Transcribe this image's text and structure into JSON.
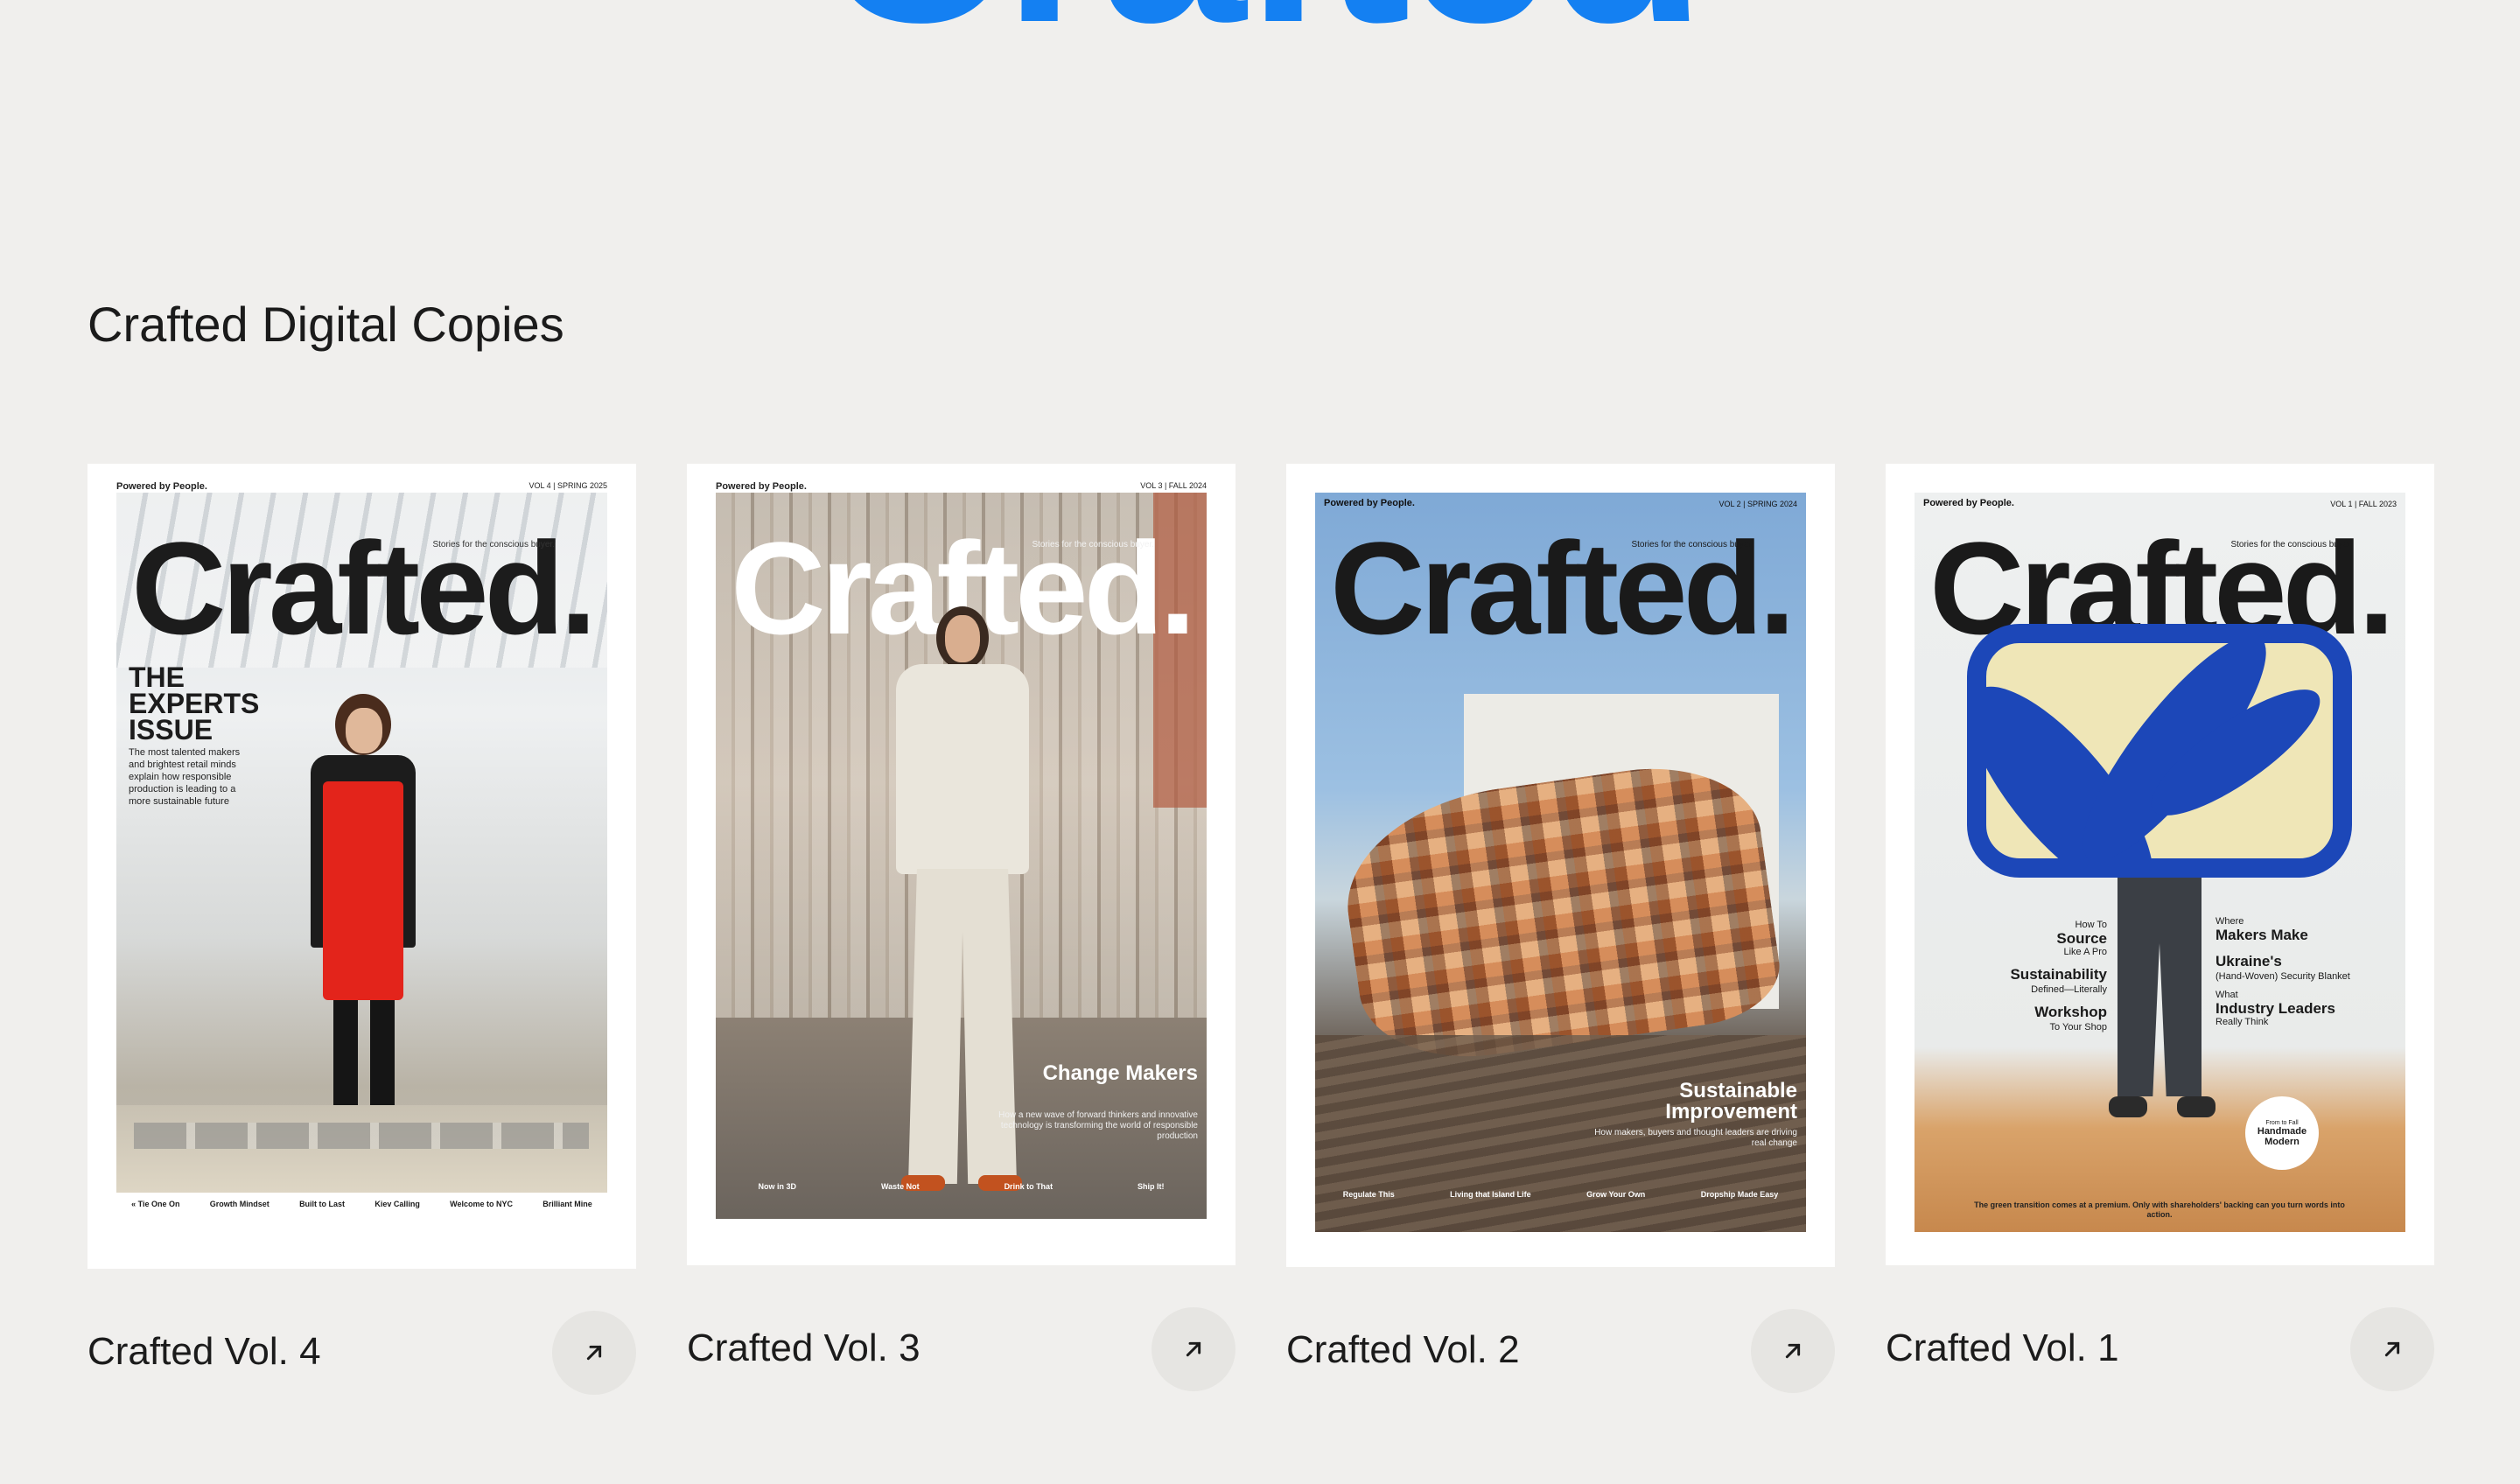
{
  "hero": {
    "partial_text": "Crafted"
  },
  "section": {
    "title": "Crafted Digital Copies"
  },
  "colors": {
    "accent": "#1480f2",
    "background": "#f0efed",
    "button_bg": "#e6e5e2"
  },
  "cards": [
    {
      "title": "Crafted Vol. 4",
      "cover": {
        "brand": "Powered by People.",
        "vol": "VOL 4 | SPRING 2025",
        "masthead": "Crafted.",
        "tagline": "Stories for the conscious buyer.",
        "headline": "THE EXPERTS ISSUE",
        "subhead": "The most talented makers and brightest retail minds explain how responsible production is leading to a more sustainable future",
        "footer": [
          "« Tie One On",
          "Growth Mindset",
          "Built to Last",
          "Kiev Calling",
          "Welcome to NYC",
          "Brilliant Mine"
        ]
      },
      "icon": "arrow-up-right-icon"
    },
    {
      "title": "Crafted Vol. 3",
      "cover": {
        "brand": "Powered by People.",
        "vol": "VOL 3 | FALL 2024",
        "masthead": "Crafted.",
        "tagline": "Stories for the conscious buyer.",
        "headline": "Change Makers",
        "subhead": "How a new wave of forward thinkers and innovative technology is transforming the world of responsible production",
        "footer": [
          "Now in 3D",
          "Waste Not",
          "Drink to That",
          "Ship It!"
        ]
      },
      "icon": "arrow-up-right-icon"
    },
    {
      "title": "Crafted Vol. 2",
      "cover": {
        "brand": "Powered by People.",
        "vol": "VOL 2 | SPRING 2024",
        "masthead": "Crafted.",
        "tagline": "Stories for the conscious buyer.",
        "headline": "Sustainable Improvement",
        "subhead": "How makers, buyers and thought leaders are driving real change",
        "footer": [
          "Regulate This",
          "Living that Island Life",
          "Grow Your Own",
          "Dropship Made Easy"
        ]
      },
      "icon": "arrow-up-right-icon"
    },
    {
      "title": "Crafted Vol. 1",
      "cover": {
        "brand": "Powered by People.",
        "vol": "VOL 1 | FALL 2023",
        "masthead": "Crafted.",
        "tagline": "Stories for the conscious buyer.",
        "left_lines": [
          "How To",
          "Source",
          "Like A Pro",
          "Sustainability",
          "Defined—Literally",
          "Workshop",
          "To Your Shop"
        ],
        "right_lines": [
          "Where",
          "Makers Make",
          "Ukraine's",
          "(Hand-Woven) Security Blanket",
          "What",
          "Industry Leaders",
          "Really Think"
        ],
        "badge_small": "From to Fall",
        "badge": "Handmade Modern",
        "quote": "The green transition comes at a premium. Only with shareholders' backing can you turn words into action."
      },
      "icon": "arrow-up-right-icon"
    }
  ]
}
